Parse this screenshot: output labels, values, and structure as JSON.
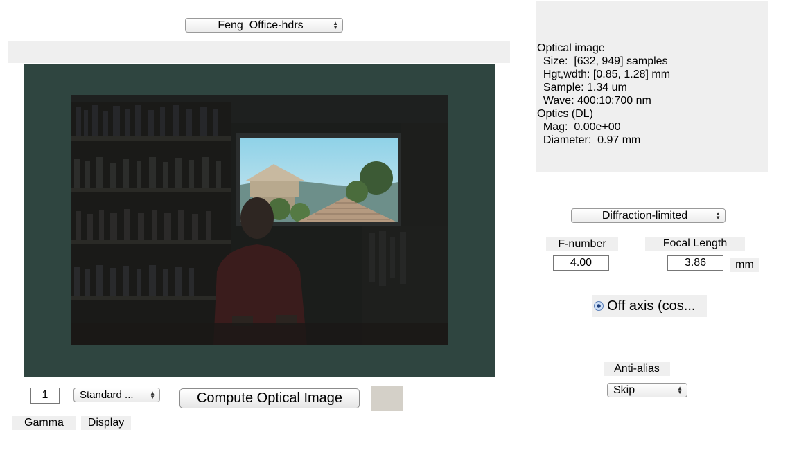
{
  "scene_select": {
    "value": "Feng_Office-hdrs"
  },
  "info": {
    "lines": [
      "Optical image",
      "  Size:  [632, 949] samples",
      "  Hgt,wdth: [0.85, 1.28] mm",
      "  Sample: 1.34 um",
      "  Wave: 400:10:700 nm",
      "Optics (DL)",
      "  Mag:  0.00e+00",
      "  Diameter:  0.97 mm"
    ]
  },
  "optics_model_select": {
    "value": "Diffraction-limited"
  },
  "fnumber": {
    "label": "F-number",
    "value": "4.00"
  },
  "focal_length": {
    "label": "Focal Length",
    "value": "3.86",
    "unit": "mm"
  },
  "off_axis": {
    "label": "Off axis (cos...",
    "checked": true
  },
  "anti_alias": {
    "label": "Anti-alias",
    "value": "Skip"
  },
  "bottom": {
    "gamma_value": "1",
    "display_select": "Standard ...",
    "compute_button": "Compute Optical Image",
    "gamma_label": "Gamma",
    "display_label": "Display"
  },
  "colors": {
    "image_background": "#2f4540",
    "panel_gray": "#efefef",
    "swatch": "#d4d0c8"
  }
}
